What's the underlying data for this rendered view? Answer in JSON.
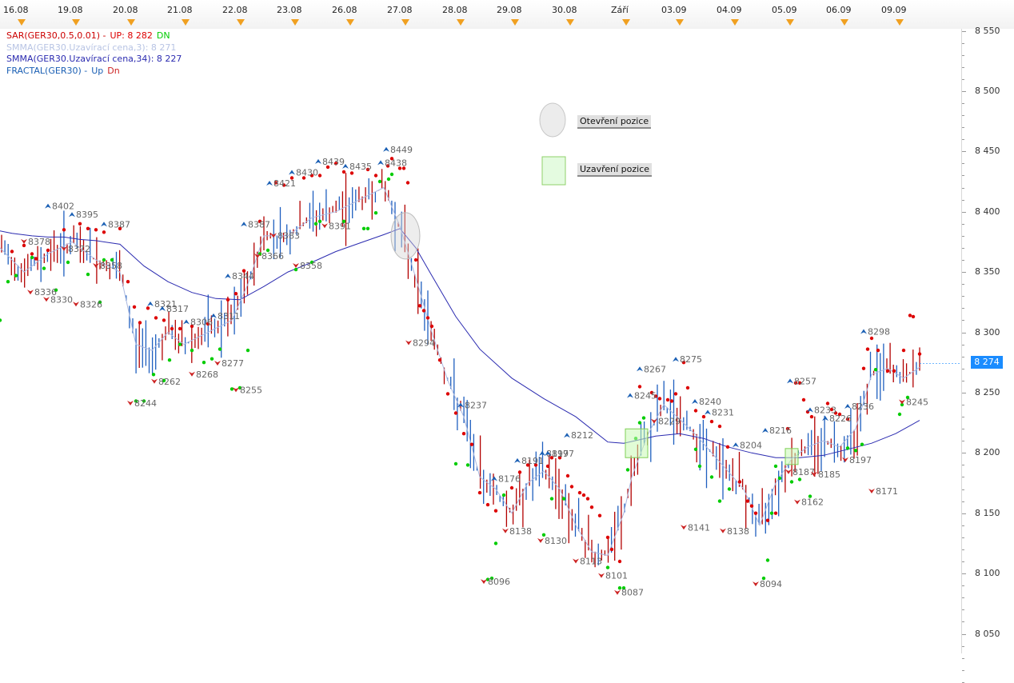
{
  "date_axis": [
    "16.08",
    "19.08",
    "20.08",
    "21.08",
    "22.08",
    "23.08",
    "26.08",
    "27.08",
    "28.08",
    "29.08",
    "30.08",
    "Září",
    "03.09",
    "04.09",
    "05.09",
    "06.09",
    "09.09"
  ],
  "legend": [
    {
      "name": "SAR(GER30,0.5,0.01)",
      "suffix": " -",
      "up": "UP: 8 282",
      "dn": "DN",
      "color": "#cc0000"
    },
    {
      "name": "SMMA(GER30.Uzavírací cena,3): 8 271",
      "color": "#b8c4e4"
    },
    {
      "name": "SMMA(GER30.Uzavírací cena,34): 8 227",
      "color": "#2b2bb0"
    },
    {
      "name": "FRACTAL(GER30)",
      "suffix": " -",
      "up": "Up",
      "dn": "Dn",
      "color": "#1a5fb4"
    }
  ],
  "price_axis": [
    "8 550",
    "8 500",
    "8 450",
    "8 400",
    "8 350",
    "8 300",
    "8 250",
    "8 200",
    "8 150",
    "8 100",
    "8 050"
  ],
  "current_price": "8 274",
  "position_legend": {
    "open": "Otevření pozice",
    "close": "Uzavření pozice"
  },
  "colors": {
    "bull": "#1f5fbf",
    "bear": "#b20000",
    "sar_up": "#00cc00",
    "sar_dn": "#dd0000",
    "smma3": "#aab8e0",
    "smma34": "#2b2bb0",
    "fractal_up": "#1a5fb4",
    "fractal_dn": "#cc2222",
    "price_badge": "#1a8cff"
  },
  "chart_data": {
    "type": "line",
    "title": "",
    "y_range": [
      8040,
      8560
    ],
    "smma34": {
      "name": "SMMA(GER30.Uzavírací cena,34)",
      "x": [
        0,
        15,
        40,
        60,
        80,
        100,
        120,
        150,
        180,
        210,
        240,
        270,
        300,
        330,
        360,
        390,
        420,
        450,
        480,
        500,
        520,
        540,
        570,
        600,
        640,
        680,
        720,
        760,
        780,
        800,
        820,
        850,
        880,
        910,
        940,
        970,
        1000,
        1030,
        1060,
        1090,
        1120,
        1150
      ],
      "y": [
        8384,
        8382,
        8380,
        8379,
        8379,
        8377,
        8376,
        8373,
        8355,
        8342,
        8333,
        8328,
        8327,
        8338,
        8350,
        8358,
        8367,
        8374,
        8381,
        8386,
        8370,
        8347,
        8313,
        8286,
        8262,
        8245,
        8230,
        8209,
        8208,
        8211,
        8214,
        8216,
        8212,
        8205,
        8200,
        8196,
        8196,
        8198,
        8203,
        8208,
        8216,
        8227
      ]
    },
    "smma3": {
      "name": "SMMA(GER30.Uzavírací cena,3)",
      "x": [
        0,
        30,
        60,
        90,
        120,
        150,
        170,
        190,
        210,
        230,
        260,
        290,
        310,
        330,
        360,
        390,
        420,
        450,
        480,
        500,
        520,
        540,
        560,
        580,
        600,
        620,
        640,
        660,
        680,
        700,
        720,
        740,
        760,
        780,
        790,
        810,
        830,
        850,
        870,
        890,
        910,
        930,
        950,
        970,
        990,
        1010,
        1030,
        1050,
        1070,
        1090,
        1110,
        1130,
        1150
      ],
      "y": [
        8370,
        8350,
        8365,
        8375,
        8360,
        8350,
        8290,
        8285,
        8300,
        8290,
        8300,
        8310,
        8340,
        8380,
        8380,
        8395,
        8400,
        8410,
        8420,
        8388,
        8345,
        8300,
        8260,
        8230,
        8180,
        8170,
        8150,
        8175,
        8185,
        8170,
        8140,
        8118,
        8115,
        8150,
        8180,
        8215,
        8240,
        8228,
        8215,
        8200,
        8185,
        8170,
        8140,
        8175,
        8195,
        8205,
        8210,
        8205,
        8220,
        8265,
        8270,
        8262,
        8271
      ]
    },
    "fractal_up": [
      [
        "",
        60,
        8402
      ],
      [
        "",
        90,
        8395
      ],
      [
        "",
        130,
        8387
      ],
      [
        "",
        188,
        8321
      ],
      [
        "",
        203,
        8317
      ],
      [
        "",
        233,
        8306
      ],
      [
        "",
        267,
        8311
      ],
      [
        "",
        285,
        8344
      ],
      [
        "",
        305,
        8387
      ],
      [
        "",
        337,
        8421
      ],
      [
        "",
        365,
        8430
      ],
      [
        "",
        398,
        8439
      ],
      [
        "",
        432,
        8435
      ],
      [
        "",
        476,
        8438
      ],
      [
        "",
        483,
        8449
      ],
      [
        "",
        576,
        8237
      ],
      [
        "",
        618,
        8176
      ],
      [
        "",
        647,
        8191
      ],
      [
        "",
        678,
        8197
      ],
      [
        "",
        685,
        8197
      ],
      [
        "",
        709,
        8212
      ],
      [
        "",
        788,
        8245
      ],
      [
        "",
        800,
        8267
      ],
      [
        "",
        845,
        8275
      ],
      [
        "",
        869,
        8240
      ],
      [
        "",
        885,
        8231
      ],
      [
        "",
        920,
        8204
      ],
      [
        "",
        957,
        8216
      ],
      [
        "",
        988,
        8257
      ],
      [
        "",
        1013,
        8233
      ],
      [
        "",
        1032,
        8226
      ],
      [
        "",
        1060,
        8236
      ],
      [
        "",
        1080,
        8298
      ]
    ],
    "fractal_dn": [
      [
        "",
        30,
        8378
      ],
      [
        "",
        38,
        8336
      ],
      [
        "",
        58,
        8330
      ],
      [
        "",
        80,
        8372
      ],
      [
        "",
        95,
        8326
      ],
      [
        "",
        120,
        8358
      ],
      [
        "",
        163,
        8244
      ],
      [
        "",
        193,
        8262
      ],
      [
        "",
        240,
        8268
      ],
      [
        "",
        272,
        8277
      ],
      [
        "",
        295,
        8255
      ],
      [
        "",
        322,
        8366
      ],
      [
        "",
        342,
        8383
      ],
      [
        "",
        370,
        8358
      ],
      [
        "",
        406,
        8391
      ],
      [
        "",
        511,
        8294
      ],
      [
        "",
        605,
        8096
      ],
      [
        "",
        632,
        8138
      ],
      [
        "",
        676,
        8130
      ],
      [
        "",
        720,
        8113
      ],
      [
        "",
        752,
        8101
      ],
      [
        "",
        772,
        8087
      ],
      [
        "",
        818,
        8229
      ],
      [
        "",
        855,
        8141
      ],
      [
        "",
        904,
        8138
      ],
      [
        "",
        945,
        8094
      ],
      [
        "",
        986,
        8187
      ],
      [
        "",
        997,
        8162
      ],
      [
        "",
        1018,
        8185
      ],
      [
        "",
        1057,
        8197
      ],
      [
        "",
        1090,
        8171
      ],
      [
        "",
        1128,
        8245
      ]
    ],
    "sar_up_points": [
      [
        0,
        8310
      ],
      [
        10,
        8342
      ],
      [
        20,
        8347
      ],
      [
        40,
        8362
      ],
      [
        55,
        8353
      ],
      [
        70,
        8335
      ],
      [
        85,
        8358
      ],
      [
        110,
        8348
      ],
      [
        125,
        8325
      ],
      [
        130,
        8360
      ],
      [
        140,
        8360
      ],
      [
        170,
        8243
      ],
      [
        180,
        8243
      ],
      [
        192,
        8265
      ],
      [
        205,
        8260
      ],
      [
        212,
        8277
      ],
      [
        225,
        8290
      ],
      [
        240,
        8285
      ],
      [
        255,
        8275
      ],
      [
        265,
        8278
      ],
      [
        275,
        8286
      ],
      [
        290,
        8253
      ],
      [
        300,
        8254
      ],
      [
        310,
        8285
      ],
      [
        325,
        8365
      ],
      [
        335,
        8368
      ],
      [
        370,
        8352
      ],
      [
        390,
        8358
      ],
      [
        395,
        8390
      ],
      [
        400,
        8392
      ],
      [
        430,
        8392
      ],
      [
        455,
        8386
      ],
      [
        460,
        8386
      ],
      [
        470,
        8399
      ],
      [
        475,
        8425
      ],
      [
        486,
        8427
      ],
      [
        490,
        8431
      ],
      [
        570,
        8191
      ],
      [
        585,
        8190
      ],
      [
        610,
        8095
      ],
      [
        615,
        8096
      ],
      [
        620,
        8125
      ],
      [
        630,
        8165
      ],
      [
        680,
        8132
      ],
      [
        690,
        8162
      ],
      [
        705,
        8162
      ],
      [
        760,
        8105
      ],
      [
        775,
        8088
      ],
      [
        780,
        8088
      ],
      [
        785,
        8186
      ],
      [
        795,
        8212
      ],
      [
        800,
        8225
      ],
      [
        805,
        8229
      ],
      [
        870,
        8203
      ],
      [
        875,
        8189
      ],
      [
        890,
        8180
      ],
      [
        900,
        8160
      ],
      [
        912,
        8170
      ],
      [
        955,
        8096
      ],
      [
        960,
        8111
      ],
      [
        965,
        8150
      ],
      [
        970,
        8189
      ],
      [
        975,
        8179
      ],
      [
        990,
        8176
      ],
      [
        1000,
        8178
      ],
      [
        1013,
        8164
      ],
      [
        1060,
        8204
      ],
      [
        1070,
        8202
      ],
      [
        1078,
        8207
      ],
      [
        1095,
        8269
      ],
      [
        1125,
        8232
      ],
      [
        1128,
        8240
      ],
      [
        1135,
        8246
      ]
    ],
    "sar_dn_points": [
      [
        15,
        8367
      ],
      [
        30,
        8372
      ],
      [
        40,
        8365
      ],
      [
        45,
        8361
      ],
      [
        60,
        8368
      ],
      [
        80,
        8385
      ],
      [
        100,
        8390
      ],
      [
        110,
        8386
      ],
      [
        120,
        8385
      ],
      [
        130,
        8383
      ],
      [
        150,
        8386
      ],
      [
        160,
        8342
      ],
      [
        168,
        8321
      ],
      [
        175,
        8308
      ],
      [
        185,
        8320
      ],
      [
        195,
        8312
      ],
      [
        205,
        8310
      ],
      [
        215,
        8303
      ],
      [
        225,
        8303
      ],
      [
        240,
        8305
      ],
      [
        260,
        8307
      ],
      [
        285,
        8327
      ],
      [
        295,
        8332
      ],
      [
        305,
        8351
      ],
      [
        325,
        8392
      ],
      [
        345,
        8424
      ],
      [
        355,
        8422
      ],
      [
        365,
        8428
      ],
      [
        380,
        8428
      ],
      [
        390,
        8430
      ],
      [
        400,
        8430
      ],
      [
        410,
        8437
      ],
      [
        420,
        8440
      ],
      [
        430,
        8433
      ],
      [
        440,
        8432
      ],
      [
        460,
        8435
      ],
      [
        470,
        8430
      ],
      [
        485,
        8438
      ],
      [
        490,
        8444
      ],
      [
        500,
        8436
      ],
      [
        505,
        8436
      ],
      [
        510,
        8424
      ],
      [
        520,
        8360
      ],
      [
        525,
        8322
      ],
      [
        530,
        8318
      ],
      [
        535,
        8312
      ],
      [
        540,
        8305
      ],
      [
        550,
        8277
      ],
      [
        560,
        8249
      ],
      [
        570,
        8233
      ],
      [
        580,
        8216
      ],
      [
        590,
        8207
      ],
      [
        600,
        8167
      ],
      [
        610,
        8157
      ],
      [
        620,
        8152
      ],
      [
        640,
        8171
      ],
      [
        650,
        8184
      ],
      [
        660,
        8190
      ],
      [
        670,
        8190
      ],
      [
        685,
        8189
      ],
      [
        690,
        8196
      ],
      [
        700,
        8196
      ],
      [
        710,
        8181
      ],
      [
        715,
        8172
      ],
      [
        725,
        8167
      ],
      [
        730,
        8165
      ],
      [
        735,
        8162
      ],
      [
        740,
        8155
      ],
      [
        750,
        8148
      ],
      [
        760,
        8130
      ],
      [
        765,
        8120
      ],
      [
        775,
        8110
      ],
      [
        800,
        8255
      ],
      [
        815,
        8250
      ],
      [
        820,
        8247
      ],
      [
        825,
        8245
      ],
      [
        835,
        8244
      ],
      [
        840,
        8243
      ],
      [
        845,
        8249
      ],
      [
        855,
        8275
      ],
      [
        860,
        8254
      ],
      [
        870,
        8235
      ],
      [
        880,
        8230
      ],
      [
        890,
        8226
      ],
      [
        900,
        8222
      ],
      [
        910,
        8205
      ],
      [
        925,
        8176
      ],
      [
        935,
        8160
      ],
      [
        940,
        8156
      ],
      [
        945,
        8150
      ],
      [
        960,
        8144
      ],
      [
        970,
        8150
      ],
      [
        985,
        8220
      ],
      [
        995,
        8258
      ],
      [
        1000,
        8258
      ],
      [
        1005,
        8244
      ],
      [
        1010,
        8234
      ],
      [
        1015,
        8230
      ],
      [
        1035,
        8241
      ],
      [
        1040,
        8236
      ],
      [
        1045,
        8233
      ],
      [
        1050,
        8232
      ],
      [
        1060,
        8228
      ],
      [
        1080,
        8270
      ],
      [
        1085,
        8286
      ],
      [
        1090,
        8295
      ],
      [
        1098,
        8285
      ],
      [
        1110,
        8268
      ],
      [
        1118,
        8268
      ],
      [
        1130,
        8285
      ],
      [
        1138,
        8314
      ],
      [
        1142,
        8313
      ],
      [
        1150,
        8282
      ]
    ],
    "position_markers": [
      {
        "type": "open",
        "x": 507,
        "y": 8380
      },
      {
        "type": "close",
        "x": 796,
        "y": 8208
      },
      {
        "type": "close",
        "x": 990,
        "y": 8197
      }
    ]
  }
}
